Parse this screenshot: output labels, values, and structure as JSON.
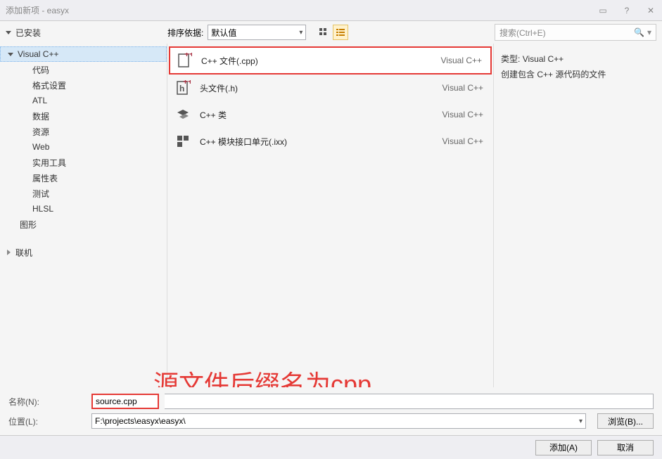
{
  "window": {
    "title": "添加新项 - easyx"
  },
  "toolbar": {
    "installed": "已安装",
    "sort_label": "排序依据:",
    "sort_value": "默认值",
    "search_placeholder": "搜索(Ctrl+E)"
  },
  "tree": {
    "root": "Visual C++",
    "children": [
      "代码",
      "格式设置",
      "ATL",
      "数据",
      "资源",
      "Web",
      "实用工具",
      "属性表",
      "测试",
      "HLSL",
      "图形"
    ],
    "online": "联机"
  },
  "items": [
    {
      "name": "C++ 文件(.cpp)",
      "lang": "Visual C++",
      "selected": true
    },
    {
      "name": "头文件(.h)",
      "lang": "Visual C++",
      "selected": false
    },
    {
      "name": "C++ 类",
      "lang": "Visual C++",
      "selected": false
    },
    {
      "name": "C++ 模块接口单元(.ixx)",
      "lang": "Visual C++",
      "selected": false
    }
  ],
  "details": {
    "type_label": "类型:",
    "type_value": "Visual C++",
    "desc": "创建包含 C++ 源代码的文件"
  },
  "annotation": "源文件后缀名为cpp",
  "form": {
    "name_label": "名称(N):",
    "name_value": "source.cpp",
    "location_label": "位置(L):",
    "location_value": "F:\\projects\\easyx\\easyx\\",
    "browse": "浏览(B)..."
  },
  "buttons": {
    "add": "添加(A)",
    "cancel": "取消"
  }
}
